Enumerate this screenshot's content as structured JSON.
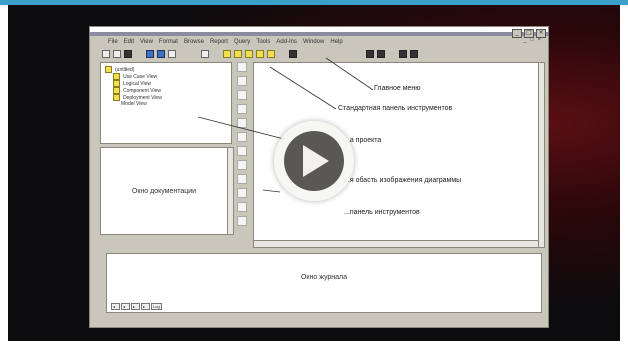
{
  "menu": [
    "File",
    "Edit",
    "View",
    "Format",
    "Browse",
    "Report",
    "Query",
    "Tools",
    "Add-Ins",
    "Window",
    "Help"
  ],
  "mdi_controls": "_ □ ×",
  "window_buttons": [
    "_",
    "□",
    "×"
  ],
  "tree": {
    "root": "(untitled)",
    "items": [
      "Use Case View",
      "Logical View",
      "Component View",
      "Deployment View",
      "Model View"
    ]
  },
  "panes": {
    "documentation": "Окно документации",
    "log": "Окно журнала"
  },
  "annotations": {
    "main_menu": "Главное меню",
    "standard_toolbar": "Стандартная панель инструментов",
    "browser": "...а проекта",
    "diagram_area": "...я обасть изображения диаграммы",
    "diagram_toolbar": "...панель инструментов"
  },
  "log_tabs": [
    "◂",
    "◂",
    "▸",
    "▸",
    "Log"
  ],
  "colors": {
    "accent_bar": "#3aa0c8",
    "play_button": "#5a5854"
  }
}
